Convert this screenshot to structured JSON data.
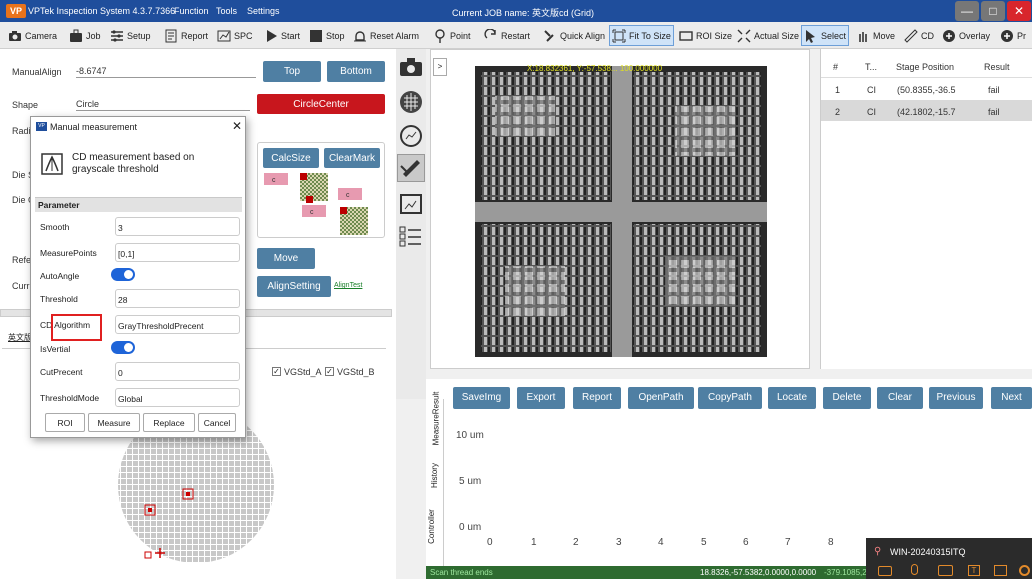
{
  "window": {
    "title": "VPTek Inspection System 4.3.7.7366",
    "menus": [
      "Function",
      "Tools",
      "Settings"
    ],
    "job_label": "Current JOB name: 英文版cd (Grid)",
    "controls": [
      "—",
      "□",
      "✕"
    ]
  },
  "toolbar": [
    "Camera",
    "Job",
    "Setup",
    "Report",
    "SPC",
    "Start",
    "Stop",
    "Reset Alarm",
    "Point",
    "Restart",
    "Quick Align",
    "Fit To Size",
    "ROI Size",
    "Actual Size",
    "Select",
    "Move",
    "CD",
    "Overlay",
    "Pr"
  ],
  "left": {
    "manual_align_label": "ManualAlign",
    "manual_align_value": "-8.6747",
    "top_btn": "Top",
    "bottom_btn": "Bottom",
    "shape_label": "Shape",
    "shape_value": "Circle",
    "circle_center_btn": "CircleCenter",
    "radius_label": "Radi",
    "die1_label": "Die S",
    "die2_label": "Die C",
    "ref_label": "Refer",
    "curr_label": "Curr",
    "calc_size": "CalcSize",
    "clear_mark": "ClearMark",
    "move_btn": "Move",
    "align_setting": "AlignSetting",
    "align_test": "AlignTest",
    "tab_label": "英文版",
    "chk_a": "VGStd_A",
    "chk_b": "VGStd_B"
  },
  "dialog": {
    "title": "Manual measurement",
    "heading": "CD measurement based on grayscale threshold",
    "section": "Parameter",
    "rows": [
      {
        "label": "Smooth",
        "value": "3"
      },
      {
        "label": "MeasurePoints",
        "value": "[0,1]"
      },
      {
        "label": "AutoAngle",
        "value": ""
      },
      {
        "label": "Threshold",
        "value": "28"
      },
      {
        "label": "CD Algorithm",
        "value": "GrayThresholdPrecent"
      },
      {
        "label": "IsVertial",
        "value": ""
      },
      {
        "label": "CutPrecent",
        "value": "0"
      },
      {
        "label": "ThresholdMode",
        "value": "Global"
      }
    ],
    "buttons": [
      "ROI",
      "Measure",
      "Replace",
      "Cancel"
    ]
  },
  "image": {
    "overlay_text": "X:18.832361, Y:-57.538... 100.000000"
  },
  "results": {
    "headers": [
      "#",
      "T...",
      "Stage Position",
      "Result"
    ],
    "rows": [
      {
        "n": "1",
        "t": "CI",
        "pos": "(50.8355,-36.5",
        "res": "fail"
      },
      {
        "n": "2",
        "t": "CI",
        "pos": "(42.1802,-15.7",
        "res": "fail"
      }
    ]
  },
  "bottom": {
    "buttons": [
      "SaveImg",
      "Export",
      "Report",
      "OpenPath",
      "CopyPath",
      "Locate",
      "Delete",
      "Clear",
      "Previous",
      "Next"
    ],
    "side_tabs": [
      "MeasureResult",
      "History",
      "Controller"
    ],
    "y_ticks": [
      "10 um",
      "5 um",
      "0 um"
    ],
    "x_ticks": [
      "0",
      "1",
      "2",
      "3",
      "4",
      "5",
      "6",
      "7",
      "8"
    ]
  },
  "status": {
    "left": "Scan thread ends",
    "coords": "18.8326,-57.5382,0.0000,0.0000",
    "extra": "-379.1085,2"
  },
  "taskbar": {
    "host": "WIN-20240315ITQ"
  }
}
